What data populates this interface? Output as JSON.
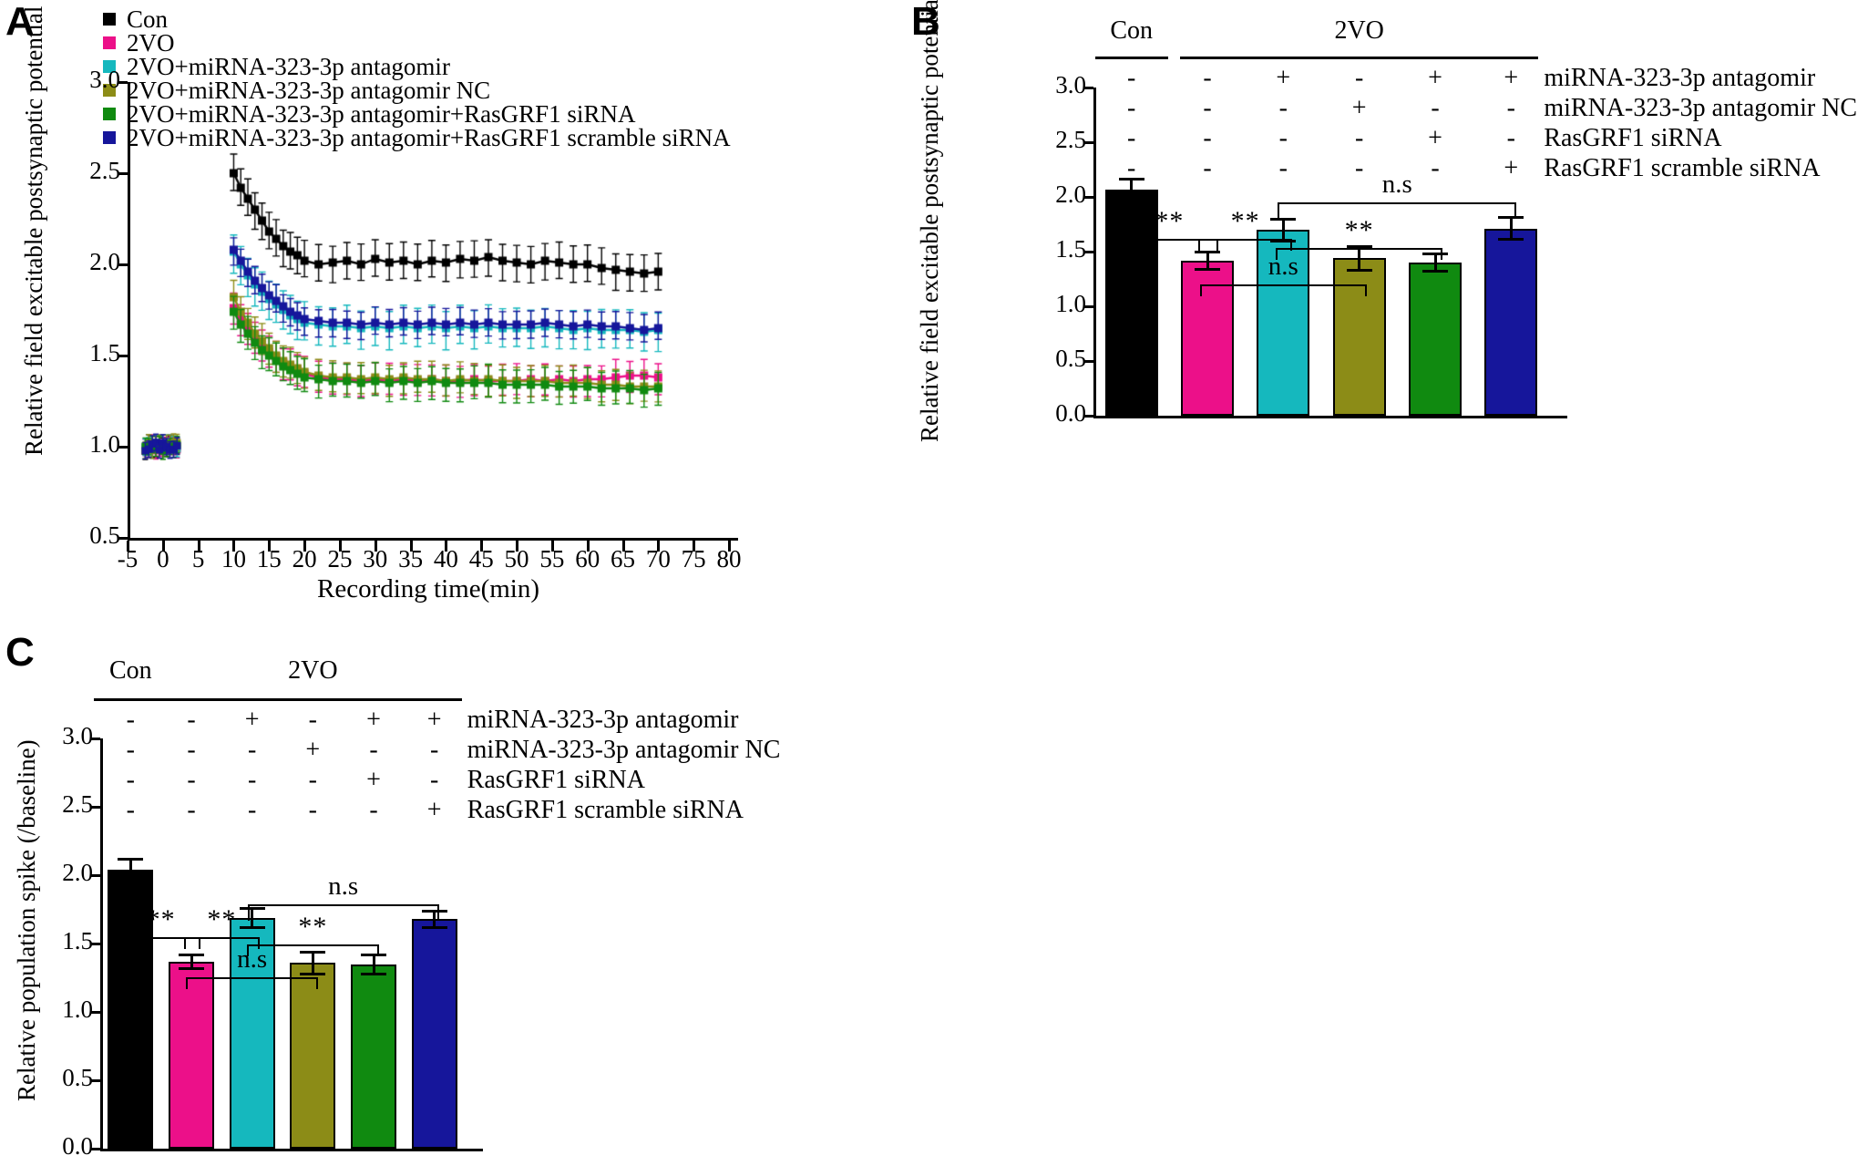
{
  "panels": {
    "A": {
      "label": "A",
      "ylabel": "Relative field excitable postsynaptic potential (/baseline)",
      "xlabel": "Recording time(min)",
      "yticks": [
        "0.5",
        "1.0",
        "1.5",
        "2.0",
        "2.5",
        "3.0"
      ],
      "xticks": [
        "-5",
        "0",
        "5",
        "10",
        "15",
        "20",
        "25",
        "30",
        "35",
        "40",
        "45",
        "50",
        "55",
        "60",
        "65",
        "70",
        "75",
        "80"
      ],
      "legend": [
        {
          "label": "Con",
          "color": "#000000"
        },
        {
          "label": "2VO",
          "color": "#EC1089"
        },
        {
          "label": "2VO+miRNA-323-3p antagomir",
          "color": "#15B8BE"
        },
        {
          "label": "2VO+miRNA-323-3p antagomir NC",
          "color": "#8C8C17"
        },
        {
          "label": "2VO+miRNA-323-3p antagomir+RasGRF1 siRNA",
          "color": "#108A10"
        },
        {
          "label": "2VO+miRNA-323-3p antagomir+RasGRF1 scramble siRNA",
          "color": "#16169B"
        }
      ]
    },
    "B": {
      "label": "B",
      "ylabel": "Relative field excitable postsynaptic potential(/baseline)",
      "yticks": [
        "0.0",
        "0.5",
        "1.0",
        "1.5",
        "2.0",
        "2.5",
        "3.0"
      ],
      "group_headers": [
        {
          "text": "Con"
        },
        {
          "text": "2VO"
        }
      ],
      "condition_rows": [
        {
          "name": "miRNA-323-3p antagomir",
          "values": [
            "-",
            "-",
            "+",
            "-",
            "+",
            "+"
          ]
        },
        {
          "name": "miRNA-323-3p antagomir NC",
          "values": [
            "-",
            "-",
            "-",
            "+",
            "-",
            "-"
          ]
        },
        {
          "name": "RasGRF1 siRNA",
          "values": [
            "-",
            "-",
            "-",
            "-",
            "+",
            "-"
          ]
        },
        {
          "name": "RasGRF1 scramble siRNA",
          "values": [
            "-",
            "-",
            "-",
            "-",
            "-",
            "+"
          ]
        }
      ],
      "significance": [
        {
          "label": "**",
          "from": 0,
          "to": 1
        },
        {
          "label": "**",
          "from": 1,
          "to": 2
        },
        {
          "label": "**",
          "from": 2,
          "to": 4
        },
        {
          "label": "n.s",
          "from": 2,
          "to": 5
        },
        {
          "label": "n.s",
          "from": 1,
          "to": 3
        }
      ]
    },
    "C": {
      "label": "C",
      "ylabel": "Relative population spike (/baseline)",
      "yticks": [
        "0.0",
        "0.5",
        "1.0",
        "1.5",
        "2.0",
        "2.5",
        "3.0"
      ],
      "group_headers": [
        {
          "text": "Con"
        },
        {
          "text": "2VO"
        }
      ],
      "condition_rows": [
        {
          "name": "miRNA-323-3p antagomir",
          "values": [
            "-",
            "-",
            "+",
            "-",
            "+",
            "+"
          ]
        },
        {
          "name": "miRNA-323-3p antagomir NC",
          "values": [
            "-",
            "-",
            "-",
            "+",
            "-",
            "-"
          ]
        },
        {
          "name": "RasGRF1 siRNA",
          "values": [
            "-",
            "-",
            "-",
            "-",
            "+",
            "-"
          ]
        },
        {
          "name": "RasGRF1 scramble siRNA",
          "values": [
            "-",
            "-",
            "-",
            "-",
            "-",
            "+"
          ]
        }
      ],
      "significance": [
        {
          "label": "**",
          "from": 0,
          "to": 1
        },
        {
          "label": "**",
          "from": 1,
          "to": 2
        },
        {
          "label": "**",
          "from": 2,
          "to": 4
        },
        {
          "label": "n.s",
          "from": 2,
          "to": 5
        },
        {
          "label": "n.s",
          "from": 1,
          "to": 3
        }
      ]
    }
  },
  "chart_data": [
    {
      "panel": "A",
      "type": "line",
      "title": "",
      "xlabel": "Recording time(min)",
      "ylabel": "Relative field excitable postsynaptic potential (/baseline)",
      "xlim": [
        -5,
        80
      ],
      "ylim": [
        0.5,
        3.0
      ],
      "grid": false,
      "legend_position": "top-left",
      "baseline_x": [
        -2.5,
        -2.0,
        -1.5,
        -1.0,
        -0.5,
        0.0,
        0.5,
        1.0,
        1.5,
        2.0
      ],
      "series": [
        {
          "name": "Con",
          "color": "#000000",
          "baseline_mean": 1.0,
          "x": [
            10,
            11,
            12,
            13,
            14,
            15,
            16,
            17,
            18,
            19,
            20,
            22,
            24,
            26,
            28,
            30,
            32,
            34,
            36,
            38,
            40,
            42,
            44,
            46,
            48,
            50,
            52,
            54,
            56,
            58,
            60,
            62,
            64,
            66,
            68,
            70
          ],
          "values": [
            2.5,
            2.42,
            2.36,
            2.3,
            2.24,
            2.18,
            2.14,
            2.1,
            2.07,
            2.05,
            2.02,
            2.0,
            2.01,
            2.02,
            2.0,
            2.03,
            2.01,
            2.02,
            2.0,
            2.02,
            2.01,
            2.03,
            2.02,
            2.04,
            2.02,
            2.01,
            2.0,
            2.02,
            2.01,
            2.0,
            2.0,
            1.98,
            1.97,
            1.96,
            1.95,
            1.96
          ],
          "error": 0.1
        },
        {
          "name": "2VO",
          "color": "#EC1089",
          "baseline_mean": 1.0,
          "x": [
            10,
            11,
            12,
            13,
            14,
            15,
            16,
            17,
            18,
            19,
            20,
            22,
            24,
            26,
            28,
            30,
            32,
            34,
            36,
            38,
            40,
            42,
            44,
            46,
            48,
            50,
            52,
            54,
            56,
            58,
            60,
            62,
            64,
            66,
            68,
            70
          ],
          "values": [
            1.76,
            1.7,
            1.65,
            1.6,
            1.56,
            1.52,
            1.49,
            1.46,
            1.44,
            1.42,
            1.4,
            1.38,
            1.37,
            1.37,
            1.36,
            1.37,
            1.36,
            1.37,
            1.36,
            1.37,
            1.36,
            1.36,
            1.37,
            1.36,
            1.36,
            1.36,
            1.37,
            1.36,
            1.37,
            1.36,
            1.37,
            1.37,
            1.38,
            1.39,
            1.39,
            1.38
          ],
          "error": 0.085
        },
        {
          "name": "2VO+miRNA-323-3p antagomir",
          "color": "#15B8BE",
          "baseline_mean": 1.0,
          "x": [
            10,
            11,
            12,
            13,
            14,
            15,
            16,
            17,
            18,
            19,
            20,
            22,
            24,
            26,
            28,
            30,
            32,
            34,
            36,
            38,
            40,
            42,
            44,
            46,
            48,
            50,
            52,
            54,
            56,
            58,
            60,
            62,
            64,
            66,
            68,
            70
          ],
          "values": [
            2.07,
            2.0,
            1.94,
            1.89,
            1.85,
            1.81,
            1.78,
            1.75,
            1.72,
            1.7,
            1.68,
            1.67,
            1.66,
            1.66,
            1.65,
            1.66,
            1.65,
            1.66,
            1.65,
            1.66,
            1.65,
            1.66,
            1.65,
            1.66,
            1.65,
            1.65,
            1.65,
            1.66,
            1.65,
            1.64,
            1.65,
            1.64,
            1.64,
            1.64,
            1.63,
            1.64
          ],
          "error": 0.105
        },
        {
          "name": "2VO+miRNA-323-3p antagomir NC",
          "color": "#8C8C17",
          "baseline_mean": 1.0,
          "x": [
            10,
            11,
            12,
            13,
            14,
            15,
            16,
            17,
            18,
            19,
            20,
            22,
            24,
            26,
            28,
            30,
            32,
            34,
            36,
            38,
            40,
            42,
            44,
            46,
            48,
            50,
            52,
            54,
            56,
            58,
            60,
            62,
            64,
            66,
            68,
            70
          ],
          "values": [
            1.82,
            1.74,
            1.68,
            1.62,
            1.58,
            1.54,
            1.5,
            1.47,
            1.45,
            1.43,
            1.41,
            1.39,
            1.38,
            1.38,
            1.37,
            1.38,
            1.37,
            1.38,
            1.37,
            1.37,
            1.36,
            1.37,
            1.36,
            1.37,
            1.36,
            1.36,
            1.36,
            1.36,
            1.35,
            1.35,
            1.35,
            1.34,
            1.34,
            1.33,
            1.33,
            1.33
          ],
          "error": 0.085
        },
        {
          "name": "2VO+miRNA-323-3p antagomir+RasGRF1 siRNA",
          "color": "#108A10",
          "baseline_mean": 1.0,
          "x": [
            10,
            11,
            12,
            13,
            14,
            15,
            16,
            17,
            18,
            19,
            20,
            22,
            24,
            26,
            28,
            30,
            32,
            34,
            36,
            38,
            40,
            42,
            44,
            46,
            48,
            50,
            52,
            54,
            56,
            58,
            60,
            62,
            64,
            66,
            68,
            70
          ],
          "values": [
            1.74,
            1.67,
            1.62,
            1.57,
            1.53,
            1.5,
            1.47,
            1.44,
            1.42,
            1.4,
            1.38,
            1.37,
            1.36,
            1.36,
            1.35,
            1.36,
            1.35,
            1.36,
            1.35,
            1.36,
            1.35,
            1.35,
            1.35,
            1.35,
            1.34,
            1.34,
            1.34,
            1.34,
            1.33,
            1.33,
            1.33,
            1.32,
            1.32,
            1.32,
            1.31,
            1.32
          ],
          "error": 0.09
        },
        {
          "name": "2VO+miRNA-323-3p antagomir+RasGRF1 scramble siRNA",
          "color": "#16169B",
          "baseline_mean": 1.0,
          "x": [
            10,
            11,
            12,
            13,
            14,
            15,
            16,
            17,
            18,
            19,
            20,
            22,
            24,
            26,
            28,
            30,
            32,
            34,
            36,
            38,
            40,
            42,
            44,
            46,
            48,
            50,
            52,
            54,
            56,
            58,
            60,
            62,
            64,
            66,
            68,
            70
          ],
          "values": [
            2.08,
            2.02,
            1.96,
            1.91,
            1.87,
            1.83,
            1.8,
            1.77,
            1.74,
            1.72,
            1.7,
            1.69,
            1.68,
            1.68,
            1.67,
            1.68,
            1.67,
            1.68,
            1.67,
            1.68,
            1.67,
            1.68,
            1.67,
            1.68,
            1.67,
            1.67,
            1.67,
            1.68,
            1.67,
            1.66,
            1.67,
            1.66,
            1.66,
            1.65,
            1.64,
            1.65
          ],
          "error": 0.075
        }
      ]
    },
    {
      "panel": "B",
      "type": "bar",
      "title": "",
      "xlabel": "",
      "ylabel": "Relative field excitable postsynaptic potential(/baseline)",
      "ylim": [
        0.0,
        3.0
      ],
      "grid": false,
      "categories": [
        "Con",
        "2VO",
        "2VO+antagomir",
        "2VO+antagomir NC",
        "2VO+antagomir+RasGRF1 siRNA",
        "2VO+antagomir+RasGRF1 scramble siRNA"
      ],
      "values": [
        2.07,
        1.42,
        1.7,
        1.44,
        1.4,
        1.71
      ],
      "errors": [
        0.09,
        0.08,
        0.1,
        0.11,
        0.08,
        0.1
      ],
      "colors": [
        "#000000",
        "#EC1089",
        "#15B8BE",
        "#8C8C17",
        "#108A10",
        "#16169B"
      ]
    },
    {
      "panel": "C",
      "type": "bar",
      "title": "",
      "xlabel": "",
      "ylabel": "Relative population spike (/baseline)",
      "ylim": [
        0.0,
        3.0
      ],
      "grid": false,
      "categories": [
        "Con",
        "2VO",
        "2VO+antagomir",
        "2VO+antagomir NC",
        "2VO+antagomir+RasGRF1 siRNA",
        "2VO+antagomir+RasGRF1 scramble siRNA"
      ],
      "values": [
        2.04,
        1.37,
        1.69,
        1.36,
        1.35,
        1.68
      ],
      "errors": [
        0.08,
        0.05,
        0.07,
        0.08,
        0.07,
        0.06
      ],
      "colors": [
        "#000000",
        "#EC1089",
        "#15B8BE",
        "#8C8C17",
        "#108A10",
        "#16169B"
      ]
    }
  ]
}
